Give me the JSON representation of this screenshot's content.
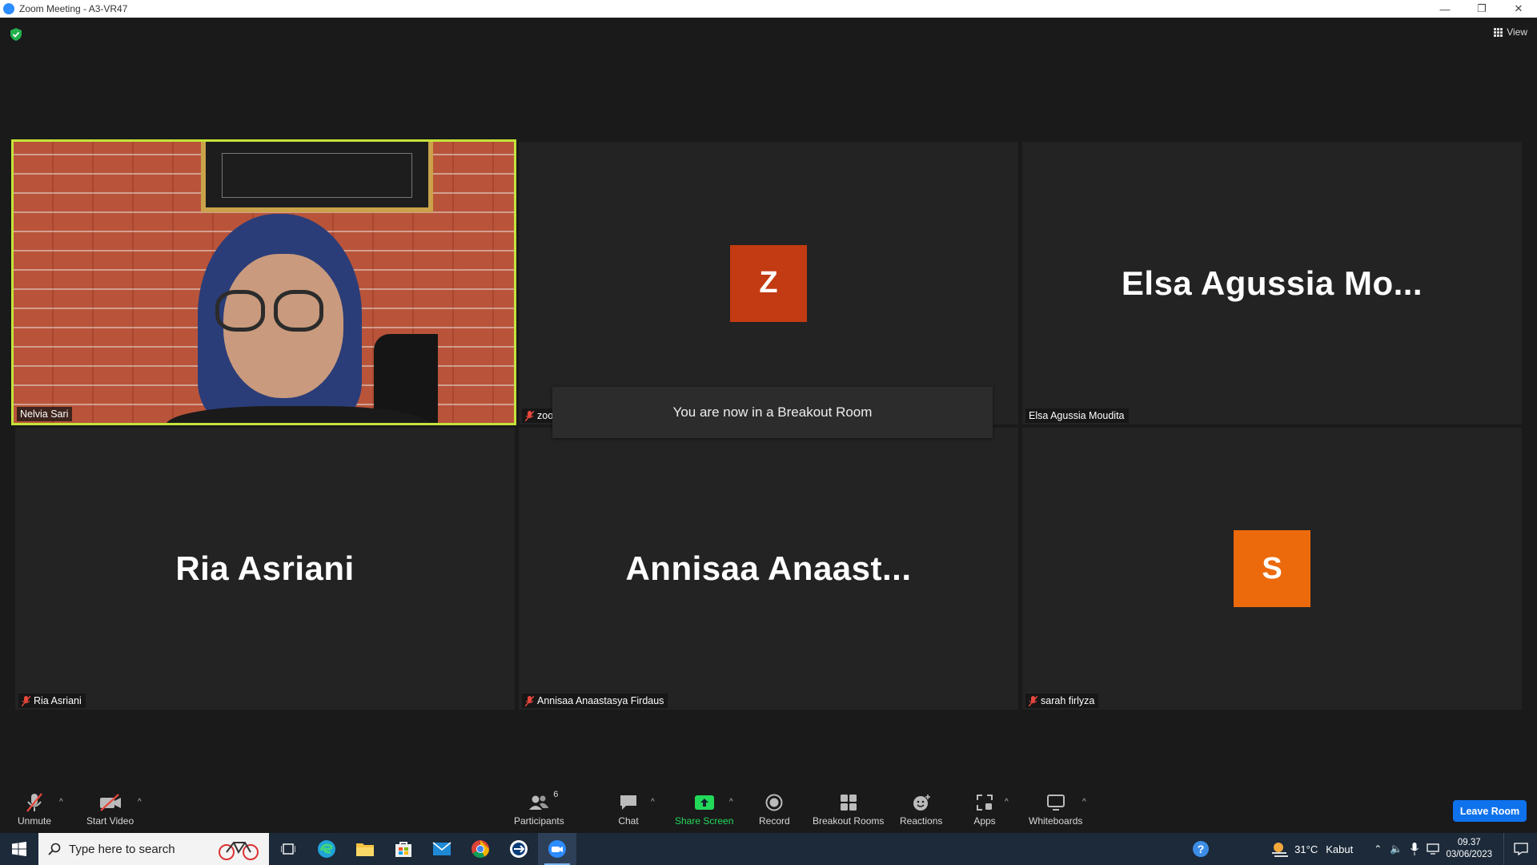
{
  "window": {
    "title": "Zoom Meeting - A3-VR47",
    "minimize_glyph": "—",
    "restore_glyph": "❐",
    "close_glyph": "✕"
  },
  "top": {
    "view_label": "View",
    "encryption_icon": "shield-check-icon"
  },
  "tiles": [
    {
      "name": "Nelvia Sari",
      "type": "video",
      "muted": false,
      "active_speaker": true
    },
    {
      "name": "zoom baa03",
      "type": "avatar",
      "initial": "Z",
      "avatar_color": "#c23b13",
      "muted": true
    },
    {
      "name": "Elsa Agussia Moudita",
      "type": "text",
      "display_name": "Elsa Agussia Mo...",
      "muted": false
    },
    {
      "name": "Ria Asriani",
      "type": "text",
      "display_name": "Ria Asriani",
      "muted": true
    },
    {
      "name": "Annisaa Anaastasya Firdaus",
      "type": "text",
      "display_name": "Annisaa  Anaast...",
      "muted": true
    },
    {
      "name": "sarah firlyza",
      "type": "avatar",
      "initial": "S",
      "avatar_color": "#ec6a0c",
      "muted": true
    }
  ],
  "notification": "You are now in a Breakout Room",
  "toolbar": {
    "unmute": "Unmute",
    "start_video": "Start Video",
    "participants": "Participants",
    "participants_count": "6",
    "chat": "Chat",
    "share_screen": "Share Screen",
    "record": "Record",
    "breakout_rooms": "Breakout Rooms",
    "reactions": "Reactions",
    "apps": "Apps",
    "whiteboards": "Whiteboards",
    "leave_room": "Leave Room",
    "caret_glyph": "^",
    "share_color": "#23d959",
    "leave_color": "#0e72ed"
  },
  "taskbar": {
    "search_placeholder": "Type here to search",
    "weather_temp": "31°C",
    "weather_desc": "Kabut",
    "time": "09.37",
    "date": "03/06/2023"
  }
}
